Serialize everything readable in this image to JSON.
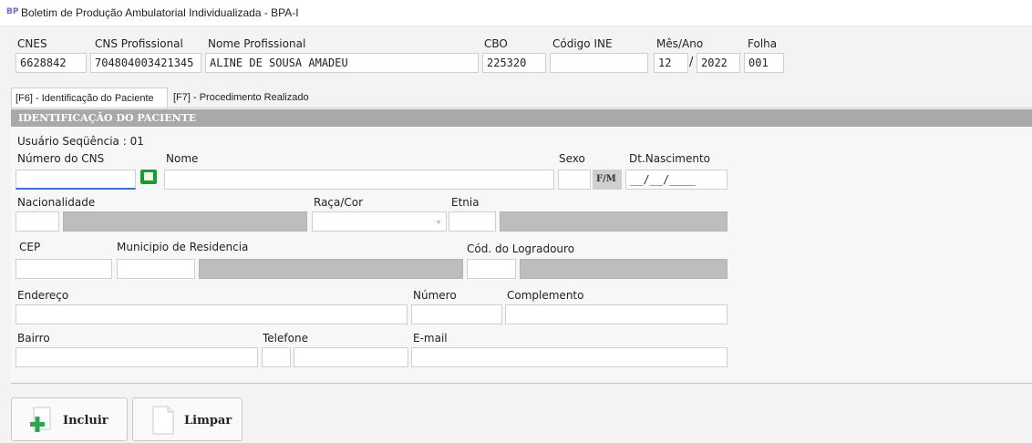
{
  "window": {
    "title": "Boletim de Produção Ambulatorial Individualizada - BPA-I",
    "icon": "app-icon"
  },
  "header": {
    "cnes": {
      "label": "CNES",
      "value": "6628842"
    },
    "cns_profissional": {
      "label": "CNS Profissional",
      "value": "704804003421345"
    },
    "nome_profissional": {
      "label": "Nome Profissional",
      "value": "ALINE DE SOUSA AMADEU"
    },
    "cbo": {
      "label": "CBO",
      "value": "225320"
    },
    "codigo_ine": {
      "label": "Código INE",
      "value": ""
    },
    "mes_ano": {
      "label": "Mês/Ano",
      "mes": "12",
      "separator": "/",
      "ano": "2022"
    },
    "folha": {
      "label": "Folha",
      "value": "001"
    }
  },
  "tabs": [
    {
      "label": "[F6] - Identificação do Paciente",
      "active": true
    },
    {
      "label": "[F7] - Procedimento Realizado",
      "active": false
    }
  ],
  "section": {
    "title": "IDENTIFICAÇÃO DO PACIENTE",
    "usuario_sequencia": "Usuário Seqüência : 01"
  },
  "form": {
    "numero_cns": "Número do CNS",
    "nome": "Nome",
    "sexo": "Sexo",
    "sexo_button": "F/M",
    "dt_nascimento": "Dt.Nascimento",
    "dt_nascimento_mask": "__/__/____",
    "nacionalidade": "Nacionalidade",
    "raca_cor": "Raça/Cor",
    "etnia": "Etnia",
    "cep": "CEP",
    "municipio": "Municipio de Residencia",
    "cod_logradouro": "Cód. do Logradouro",
    "endereco": "Endereço",
    "numero": "Número",
    "complemento": "Complemento",
    "bairro": "Bairro",
    "telefone": "Telefone",
    "email": "E-mail"
  },
  "buttons": {
    "incluir": {
      "label": "Incluir",
      "icon": "plus-icon"
    },
    "limpar": {
      "label": "Limpar",
      "icon": "blank-page-icon"
    }
  },
  "colors": {
    "section_header": "#a9a9a9",
    "readonly_field": "#bdbdbd",
    "focus_border": "#3b6fd0",
    "plus_icon": "#2fa44f"
  }
}
